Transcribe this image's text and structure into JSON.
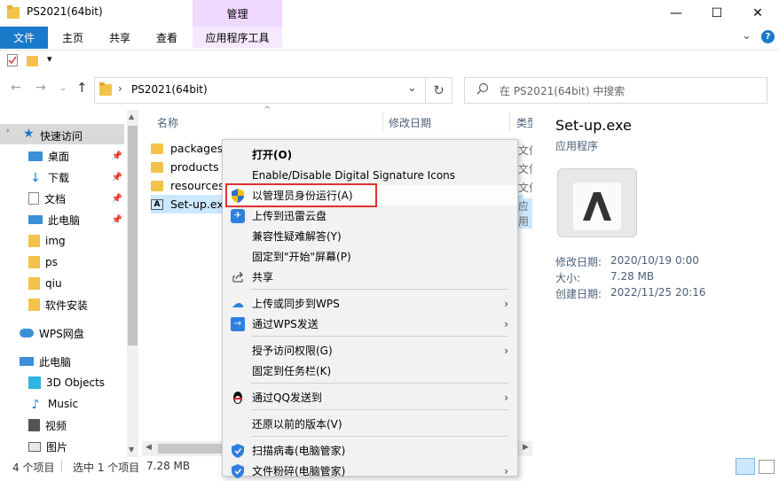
{
  "window": {
    "title": "PS2021(64bit)",
    "manage_label": "管理",
    "controls": {
      "minimize": "—",
      "maximize": "☐",
      "close": "✕"
    }
  },
  "ribbon": {
    "tabs": [
      "文件",
      "主页",
      "共享",
      "查看",
      "应用程序工具"
    ],
    "collapse": "⌄",
    "help": "?"
  },
  "qat": {
    "dropdown": "▾"
  },
  "address": {
    "path_sep": "›",
    "path": "PS2021(64bit)",
    "dropdown": "⌄",
    "refresh": "↻"
  },
  "search": {
    "placeholder": "在 PS2021(64bit) 中搜索"
  },
  "nav": {
    "quick_access": "快速访问",
    "items": [
      {
        "label": "桌面",
        "pinned": true
      },
      {
        "label": "下载",
        "pinned": true
      },
      {
        "label": "文档",
        "pinned": true
      },
      {
        "label": "此电脑",
        "pinned": true
      },
      {
        "label": "img",
        "pinned": false
      },
      {
        "label": "ps",
        "pinned": false
      },
      {
        "label": "qiu",
        "pinned": false
      },
      {
        "label": "软件安装",
        "pinned": false
      }
    ],
    "wps": "WPS网盘",
    "this_pc": "此电脑",
    "pc_items": [
      "3D Objects",
      "Music",
      "视频",
      "图片"
    ]
  },
  "list": {
    "columns": {
      "name": "名称",
      "modified": "修改日期",
      "type": "类型"
    },
    "rows": [
      {
        "name": "packages",
        "type": "文件"
      },
      {
        "name": "products",
        "type": "文件"
      },
      {
        "name": "resources",
        "type": "文件"
      },
      {
        "name": "Set-up.exe",
        "type": "应用"
      }
    ]
  },
  "preview": {
    "title": "Set-up.exe",
    "type": "应用程序",
    "modified_label": "修改日期:",
    "modified": "2020/10/19 0:00",
    "size_label": "大小:",
    "size": "7.28 MB",
    "created_label": "创建日期:",
    "created": "2022/11/25 20:16"
  },
  "status": {
    "count": "4 个项目",
    "selected": "选中 1 个项目",
    "size": "7.28 MB"
  },
  "context_menu": {
    "open": "打开(O)",
    "signature": "Enable/Disable Digital Signature Icons",
    "run_as_admin": "以管理员身份运行(A)",
    "upload_xunlei": "上传到迅雷云盘",
    "compat": "兼容性疑难解答(Y)",
    "pin_start": "固定到\"开始\"屏幕(P)",
    "share": "共享",
    "wps_sync": "上传或同步到WPS",
    "wps_send": "通过WPS发送",
    "grant_access": "授予访问权限(G)",
    "pin_taskbar": "固定到任务栏(K)",
    "qq_send": "通过QQ发送到",
    "restore": "还原以前的版本(V)",
    "scan": "扫描病毒(电脑管家)",
    "shred": "文件粉碎(电脑管家)"
  }
}
